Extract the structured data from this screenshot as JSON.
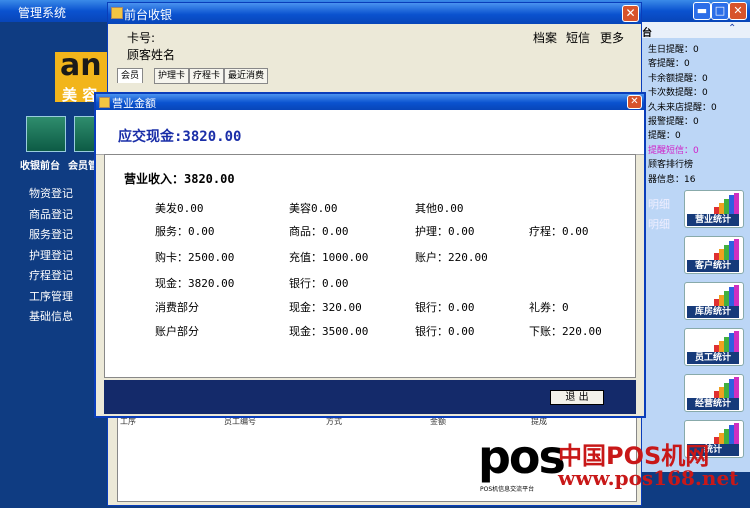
{
  "main_window": {
    "title": "管理系统",
    "minimize": "▬",
    "maximize": "□",
    "close": "✕"
  },
  "left_panel": {
    "brand_logo": "an",
    "brand_text": "美 容",
    "buttons": [
      {
        "label": "收银前台"
      },
      {
        "label": "会员管"
      }
    ],
    "menu": [
      "物资登记",
      "商品登记",
      "服务登记",
      "护理登记",
      "疗程登记",
      "工序管理",
      "基础信息"
    ]
  },
  "right_panel": {
    "header": "台",
    "items": [
      {
        "text": "生日提醒：0",
        "color": "#000000"
      },
      {
        "text": "客提醒：0",
        "color": "#000000"
      },
      {
        "text": "卡余额提醒：0",
        "color": "#000000"
      },
      {
        "text": "卡次数提醒：0",
        "color": "#000000"
      },
      {
        "text": "久未来店提醒：0",
        "color": "#000000"
      },
      {
        "text": "报警提醒：0",
        "color": "#000000"
      },
      {
        "text": "提醒：0",
        "color": "#000000"
      },
      {
        "text": "提醒短信：0",
        "color": "#d020c8"
      },
      {
        "text": "顾客排行榜",
        "color": "#000000"
      },
      {
        "text": "器信息：16",
        "color": "#000000"
      }
    ],
    "links": [
      "明细",
      "明细"
    ],
    "stat_buttons": [
      "营业统计",
      "客户统计",
      "库房统计",
      "员工统计",
      "经营统计",
      "统计"
    ]
  },
  "reception_window": {
    "title": "前台收银",
    "card_no_label": "卡号:",
    "customer_name_label": "顾客姓名",
    "top_links": [
      "档案",
      "短信",
      "更多"
    ],
    "tabs": [
      "会员",
      "护理卡",
      "疗程卡",
      "最近消费"
    ],
    "table_columns": [
      "工序",
      "员工编号",
      "方式",
      "金额",
      "提成"
    ]
  },
  "modal": {
    "title": "营业金额",
    "cash_due_label": "应交现金:3820.00",
    "revenue_label": "营业收入：3820.00",
    "rows": [
      [
        "美发0.00",
        "美容0.00",
        "其他0.00",
        ""
      ],
      [
        "服务：0.00",
        "商品：0.00",
        "护理：0.00",
        "疗程：0.00"
      ],
      [
        "购卡：2500.00",
        "充值：1000.00",
        "账户：220.00",
        ""
      ],
      [
        "现金：3820.00",
        "银行：0.00",
        "",
        ""
      ],
      [
        "消费部分",
        "现金：320.00",
        "银行：0.00",
        "礼券：0"
      ],
      [
        "账户部分",
        "现金：3500.00",
        "银行：0.00",
        "下账：220.00"
      ]
    ],
    "exit_label": "退 出"
  },
  "watermark": {
    "pos": "pos",
    "china": "中国POS机网",
    "site": "www.pos168.net",
    "sub": "POS机信息交流平台"
  }
}
